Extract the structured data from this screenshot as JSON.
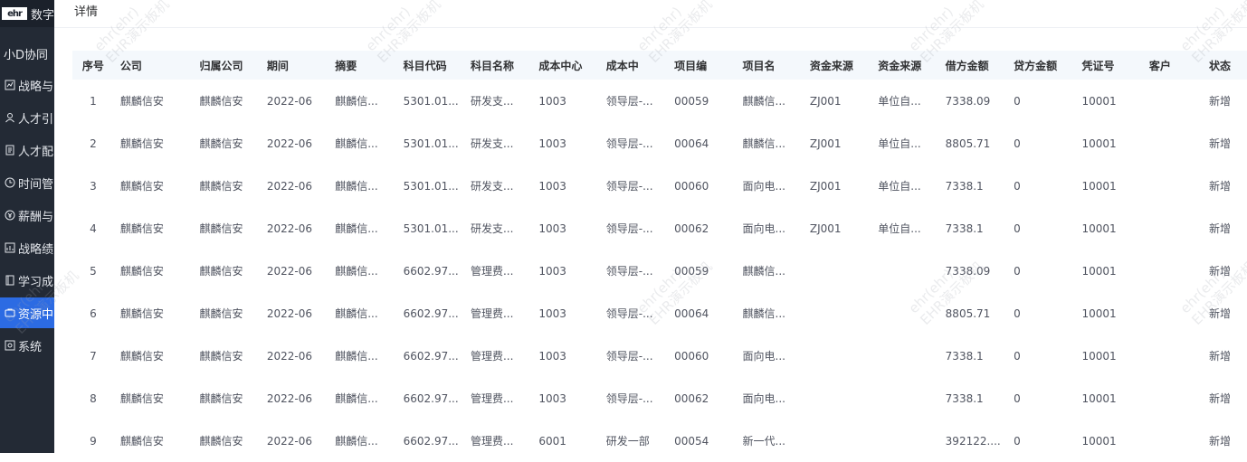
{
  "sidebar": {
    "logo_mark": "ehr",
    "logo_text": "数字",
    "subtitle": "小D协同",
    "items": [
      {
        "label": "战略与",
        "icon": "strategy-icon"
      },
      {
        "label": "人才引",
        "icon": "person-icon"
      },
      {
        "label": "人才配",
        "icon": "doc-icon"
      },
      {
        "label": "时间管",
        "icon": "clock-icon"
      },
      {
        "label": "薪酬与",
        "icon": "money-icon"
      },
      {
        "label": "战略绩",
        "icon": "chart-icon"
      },
      {
        "label": "学习成",
        "icon": "book-icon"
      },
      {
        "label": "资源中",
        "icon": "resource-icon",
        "active": true
      },
      {
        "label": "系统",
        "icon": "settings-icon"
      }
    ],
    "active_color": "#2c6be3"
  },
  "panel": {
    "title": "详情"
  },
  "table": {
    "headers": [
      "序号",
      "公司",
      "归属公司",
      "期间",
      "摘要",
      "科目代码",
      "科目名称",
      "成本中心",
      "成本中",
      "项目编",
      "项目名",
      "资金来源",
      "资金来源",
      "借方金额",
      "贷方金额",
      "凭证号",
      "客户",
      "状态"
    ],
    "rows": [
      [
        "1",
        "麒麟信安",
        "麒麟信安",
        "2022-06",
        "麒麟信...",
        "5301.01...",
        "研发支...",
        "1003",
        "领导层-...",
        "00059",
        "麒麟信...",
        "ZJ001",
        "单位自...",
        "7338.09",
        "0",
        "10001",
        "",
        "新增"
      ],
      [
        "2",
        "麒麟信安",
        "麒麟信安",
        "2022-06",
        "麒麟信...",
        "5301.01...",
        "研发支...",
        "1003",
        "领导层-...",
        "00064",
        "麒麟信...",
        "ZJ001",
        "单位自...",
        "8805.71",
        "0",
        "10001",
        "",
        "新增"
      ],
      [
        "3",
        "麒麟信安",
        "麒麟信安",
        "2022-06",
        "麒麟信...",
        "5301.01...",
        "研发支...",
        "1003",
        "领导层-...",
        "00060",
        "面向电...",
        "ZJ001",
        "单位自...",
        "7338.1",
        "0",
        "10001",
        "",
        "新增"
      ],
      [
        "4",
        "麒麟信安",
        "麒麟信安",
        "2022-06",
        "麒麟信...",
        "5301.01...",
        "研发支...",
        "1003",
        "领导层-...",
        "00062",
        "面向电...",
        "ZJ001",
        "单位自...",
        "7338.1",
        "0",
        "10001",
        "",
        "新增"
      ],
      [
        "5",
        "麒麟信安",
        "麒麟信安",
        "2022-06",
        "麒麟信...",
        "6602.97...",
        "管理费...",
        "1003",
        "领导层-...",
        "00059",
        "麒麟信...",
        "",
        "",
        "7338.09",
        "0",
        "10001",
        "",
        "新增"
      ],
      [
        "6",
        "麒麟信安",
        "麒麟信安",
        "2022-06",
        "麒麟信...",
        "6602.97...",
        "管理费...",
        "1003",
        "领导层-...",
        "00064",
        "麒麟信...",
        "",
        "",
        "8805.71",
        "0",
        "10001",
        "",
        "新增"
      ],
      [
        "7",
        "麒麟信安",
        "麒麟信安",
        "2022-06",
        "麒麟信...",
        "6602.97...",
        "管理费...",
        "1003",
        "领导层-...",
        "00060",
        "面向电...",
        "",
        "",
        "7338.1",
        "0",
        "10001",
        "",
        "新增"
      ],
      [
        "8",
        "麒麟信安",
        "麒麟信安",
        "2022-06",
        "麒麟信...",
        "6602.97...",
        "管理费...",
        "1003",
        "领导层-...",
        "00062",
        "面向电...",
        "",
        "",
        "7338.1",
        "0",
        "10001",
        "",
        "新增"
      ],
      [
        "9",
        "麒麟信安",
        "麒麟信安",
        "2022-06",
        "麒麟信...",
        "6602.97...",
        "管理费...",
        "6001",
        "研发一部",
        "00054",
        "新一代...",
        "",
        "",
        "392122....",
        "0",
        "10001",
        "",
        "新增"
      ]
    ]
  },
  "watermark": {
    "line1": "ehr(ehr)",
    "line2": "EHR演示板机"
  }
}
